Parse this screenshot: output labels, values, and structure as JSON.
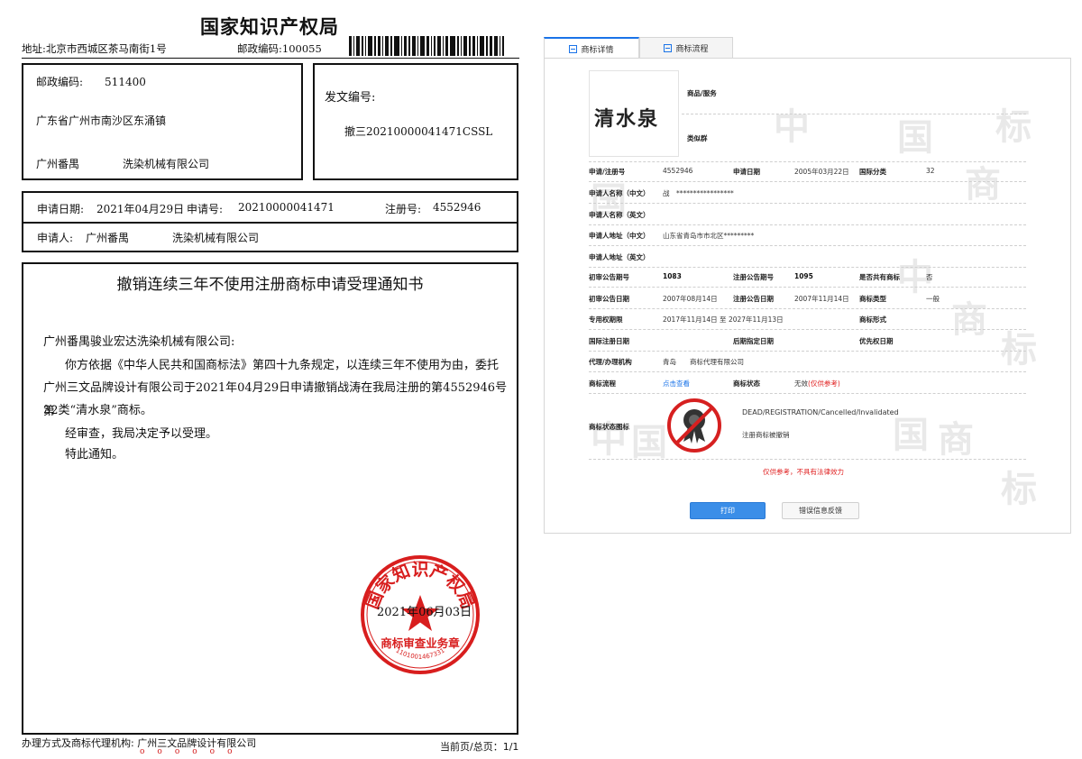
{
  "doc": {
    "authority": "国家知识产权局",
    "address": "地址:北京市西城区茶马南街1号",
    "postal_code": "邮政编码:100055",
    "recipient": {
      "postal": "邮政编码:　　511400",
      "address": "广东省广州市南沙区东涌镇",
      "name": "广州番禺　　　　洗染机械有限公司"
    },
    "doc_no_label": "发文编号:",
    "doc_no": "撤三20210000041471CSSL",
    "app_row1": {
      "date_label": "申请日期:",
      "date": "2021年04月29日",
      "appno_label": "申请号:",
      "appno": "20210000041471",
      "regno_label": "注册号:",
      "regno": "4552946"
    },
    "applicant_label": "申请人:",
    "applicant": "广州番禺　　　　洗染机械有限公司",
    "notice_title": "撤销连续三年不使用注册商标申请受理通知书",
    "addressee": "广州番禺骏业宏达洗染机械有限公司:",
    "para1_line1": "你方依据《中华人民共和国商标法》第四十九条规定，以连续三年不使用为由，委托",
    "para1_line2": "广州三文品牌设计有限公司于2021年04月29日申请撤销战涛在我局注册的第4552946号第",
    "para1_line3": "32类“清水泉”商标。",
    "para2": "经审查，我局决定予以受理。",
    "para3": "特此通知。",
    "seal_date": "2021年06月03日",
    "seal": {
      "ring_text": "国家知识产权局",
      "inner_text": "商标审查业务章",
      "code": "1101001467331"
    },
    "agency_label": "办理方式及商标代理机构:",
    "agency_name": "广州三文品牌设计有限公司",
    "page_info": "当前页/总页：1/1"
  },
  "panel": {
    "tabs": [
      {
        "label": "商标详情",
        "active": true
      },
      {
        "label": "商标流程",
        "active": false
      }
    ],
    "watermark_chars": [
      "中",
      "国",
      "商",
      "标"
    ],
    "logo_text": "清水泉",
    "goods_label": "商品/服务",
    "similar_label": "类似群",
    "rows": {
      "reg_no_label": "申请/注册号",
      "reg_no": "4552946",
      "app_date_label": "申请日期",
      "app_date": "2005年03月22日",
      "intl_class_label": "国际分类",
      "intl_class": "32",
      "applicant_cn_label": "申请人名称（中文）",
      "applicant_cn": "战　*****************",
      "applicant_en_label": "申请人名称（英文）",
      "address_cn_label": "申请人地址（中文）",
      "address_cn": "山东省青岛市市北区*********",
      "address_en_label": "申请人地址（英文）",
      "prelim_no_label": "初审公告期号",
      "prelim_no": "1083",
      "reg_pub_no_label": "注册公告期号",
      "reg_pub_no": "1095",
      "shared_label": "是否共有商标",
      "shared": "否",
      "prelim_date_label": "初审公告日期",
      "prelim_date": "2007年08月14日",
      "reg_pub_date_label": "注册公告日期",
      "reg_pub_date": "2007年11月14日",
      "type_label": "商标类型",
      "type": "一般",
      "exclusive_label": "专用权期限",
      "exclusive": "2017年11月14日 至 2027年11月13日",
      "form_label": "商标形式",
      "intl_reg_date_label": "国际注册日期",
      "later_date_label": "后期指定日期",
      "priority_label": "优先权日期",
      "agent_label": "代理/办理机构",
      "agent": "青岛　　商标代理有限公司",
      "process_label": "商标流程",
      "process_link": "点击查看",
      "status_label": "商标状态",
      "status": "无效",
      "status_note": "(仅供参考)",
      "status_icon_label": "商标状态图标",
      "status_en": "DEAD/REGISTRATION/Cancelled/Invalidated",
      "status_cn": "注册商标被撤销"
    },
    "disclaimer": "仅供参考，不具有法律效力",
    "print_button": "打印",
    "feedback_button": "错误信息反馈"
  }
}
